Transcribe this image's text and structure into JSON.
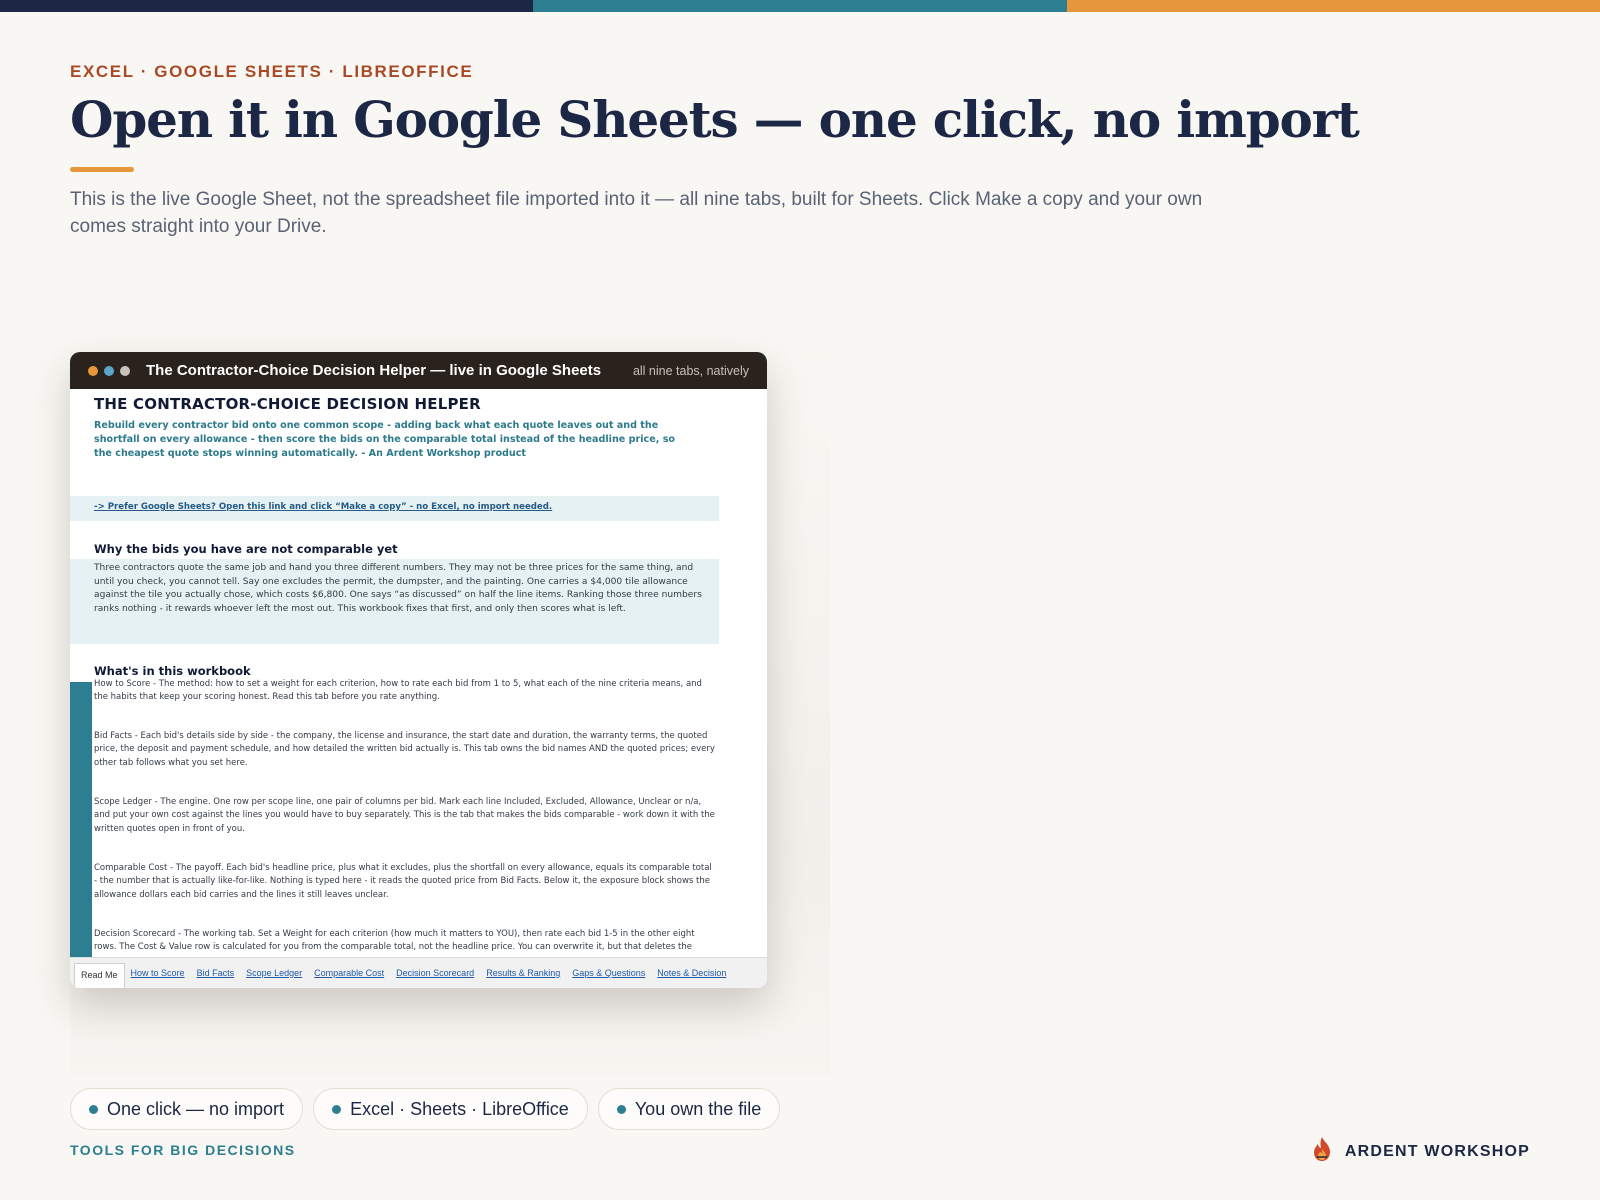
{
  "colors": {
    "navy": "#1c2745",
    "teal": "#2d7e90",
    "orange": "#e7973b",
    "rust": "#a94a26",
    "bg": "#f9f7f3"
  },
  "topbar": {
    "segments": [
      "#1c2745",
      "#2d7e90",
      "#e7973b"
    ]
  },
  "header": {
    "eyebrow": "EXCEL · GOOGLE SHEETS · LIBREOFFICE",
    "title": "Open it in Google Sheets — one click, no import",
    "lede": "This is the live Google Sheet, not the spreadsheet file imported into it — all nine tabs, built for Sheets. Click Make a copy and your own comes straight into your Drive."
  },
  "window": {
    "title": "The Contractor-Choice Decision Helper — live in Google Sheets",
    "note": "all nine tabs, natively",
    "dots": [
      "#e7973b",
      "#5aa5c9",
      "#c9c3bc"
    ]
  },
  "sheet": {
    "title": "THE CONTRACTOR-CHOICE DECISION HELPER",
    "subtitle": "Rebuild every contractor bid onto one common scope - adding back what each quote leaves out and the shortfall on every allowance - then score the bids on the comparable total instead of the headline price, so the cheapest quote stops winning automatically. - An Ardent Workshop product",
    "link": "-> Prefer Google Sheets? Open this link and click “Make a copy” - no Excel, no import needed.",
    "why_heading": "Why the bids you have are not comparable yet",
    "why_text": "Three contractors quote the same job and hand you three different numbers. They may not be three prices for the same thing, and until you check, you cannot tell. Say one excludes the permit, the dumpster, and the painting. One carries a $4,000 tile allowance against the tile you actually chose, which costs $6,800. One says “as discussed” on half the line items. Ranking those three numbers ranks nothing - it rewards whoever left the most out. This workbook fixes that first, and only then scores what is left.",
    "whats_heading": "What's in this workbook",
    "entries": [
      "How to Score - The method: how to set a weight for each criterion, how to rate each bid from 1 to 5, what each of the nine criteria means, and the habits that keep your scoring honest. Read this tab before you rate anything.",
      "Bid Facts - Each bid's details side by side - the company, the license and insurance, the start date and duration, the warranty terms, the quoted price, the deposit and payment schedule, and how detailed the written bid actually is. This tab owns the bid names AND the quoted prices; every other tab follows what you set here.",
      "Scope Ledger - The engine. One row per scope line, one pair of columns per bid. Mark each line Included, Excluded, Allowance, Unclear or n/a, and put your own cost against the lines you would have to buy separately. This is the tab that makes the bids comparable - work down it with the written quotes open in front of you.",
      "Comparable Cost - The payoff. Each bid's headline price, plus what it excludes, plus the shortfall on every allowance, equals its comparable total - the number that is actually like-for-like. Nothing is typed here - it reads the quoted price from Bid Facts. Below it, the exposure block shows the allowance dollars each bid carries and the lines it still leaves unclear.",
      "Decision Scorecard - The working tab. Set a Weight for each criterion (how much it matters to YOU), then rate each bid 1-5 in the other eight rows. The Cost & Value row is calculated for you from the comparable total, not the headline price. You can overwrite it, but that deletes the"
    ],
    "tabs": [
      "Read Me",
      "How to Score",
      "Bid Facts",
      "Scope Ledger",
      "Comparable Cost",
      "Decision Scorecard",
      "Results & Ranking",
      "Gaps & Questions",
      "Notes & Decision"
    ],
    "active_tab": "Read Me"
  },
  "pills": [
    "One click — no import",
    "Excel · Sheets · LibreOffice",
    "You own the file"
  ],
  "footer": {
    "tagline": "TOOLS FOR BIG DECISIONS",
    "brand": "ARDENT WORKSHOP",
    "brand_icon": "flame-icon"
  }
}
